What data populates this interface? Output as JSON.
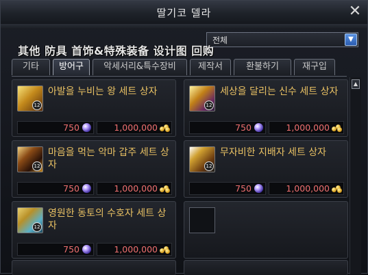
{
  "window": {
    "title": "딸기코 델라"
  },
  "overlay": {
    "text": "其他 防具 首饰&特殊装备 设计图 回购"
  },
  "filter": {
    "selected": "전체"
  },
  "tabs": [
    {
      "label": "기타",
      "active": false
    },
    {
      "label": "방어구",
      "active": true
    },
    {
      "label": "악세서리&특수장비",
      "active": false
    },
    {
      "label": "제작서",
      "active": false
    },
    {
      "label": "환불하기",
      "active": false
    },
    {
      "label": "재구입",
      "active": false
    }
  ],
  "items": [
    {
      "name": "아발을 누비는 왕 세트 상자",
      "price_gems": "750",
      "price_gold": "1,000,000"
    },
    {
      "name": "세상을 달리는 신수 세트 상자",
      "price_gems": "750",
      "price_gold": "1,000,000"
    },
    {
      "name": "마음을 먹는 악마 갑주 세트 상자",
      "price_gems": "750",
      "price_gold": "1,000,000"
    },
    {
      "name": "무자비한 지배자 세트 상자",
      "price_gems": "750",
      "price_gold": "1,000,000"
    },
    {
      "name": "영원한 동토의 수호자 세트 상자",
      "price_gems": "750",
      "price_gold": "1,000,000"
    }
  ],
  "icons": {
    "close": "close-icon",
    "dropdown": "chevron-down-icon",
    "gem": "gem-currency-icon",
    "gold": "gold-coins-icon"
  },
  "colors": {
    "item_name": "#e8c063",
    "price": "#f07070",
    "accent_blue": "#2a5cb0"
  }
}
